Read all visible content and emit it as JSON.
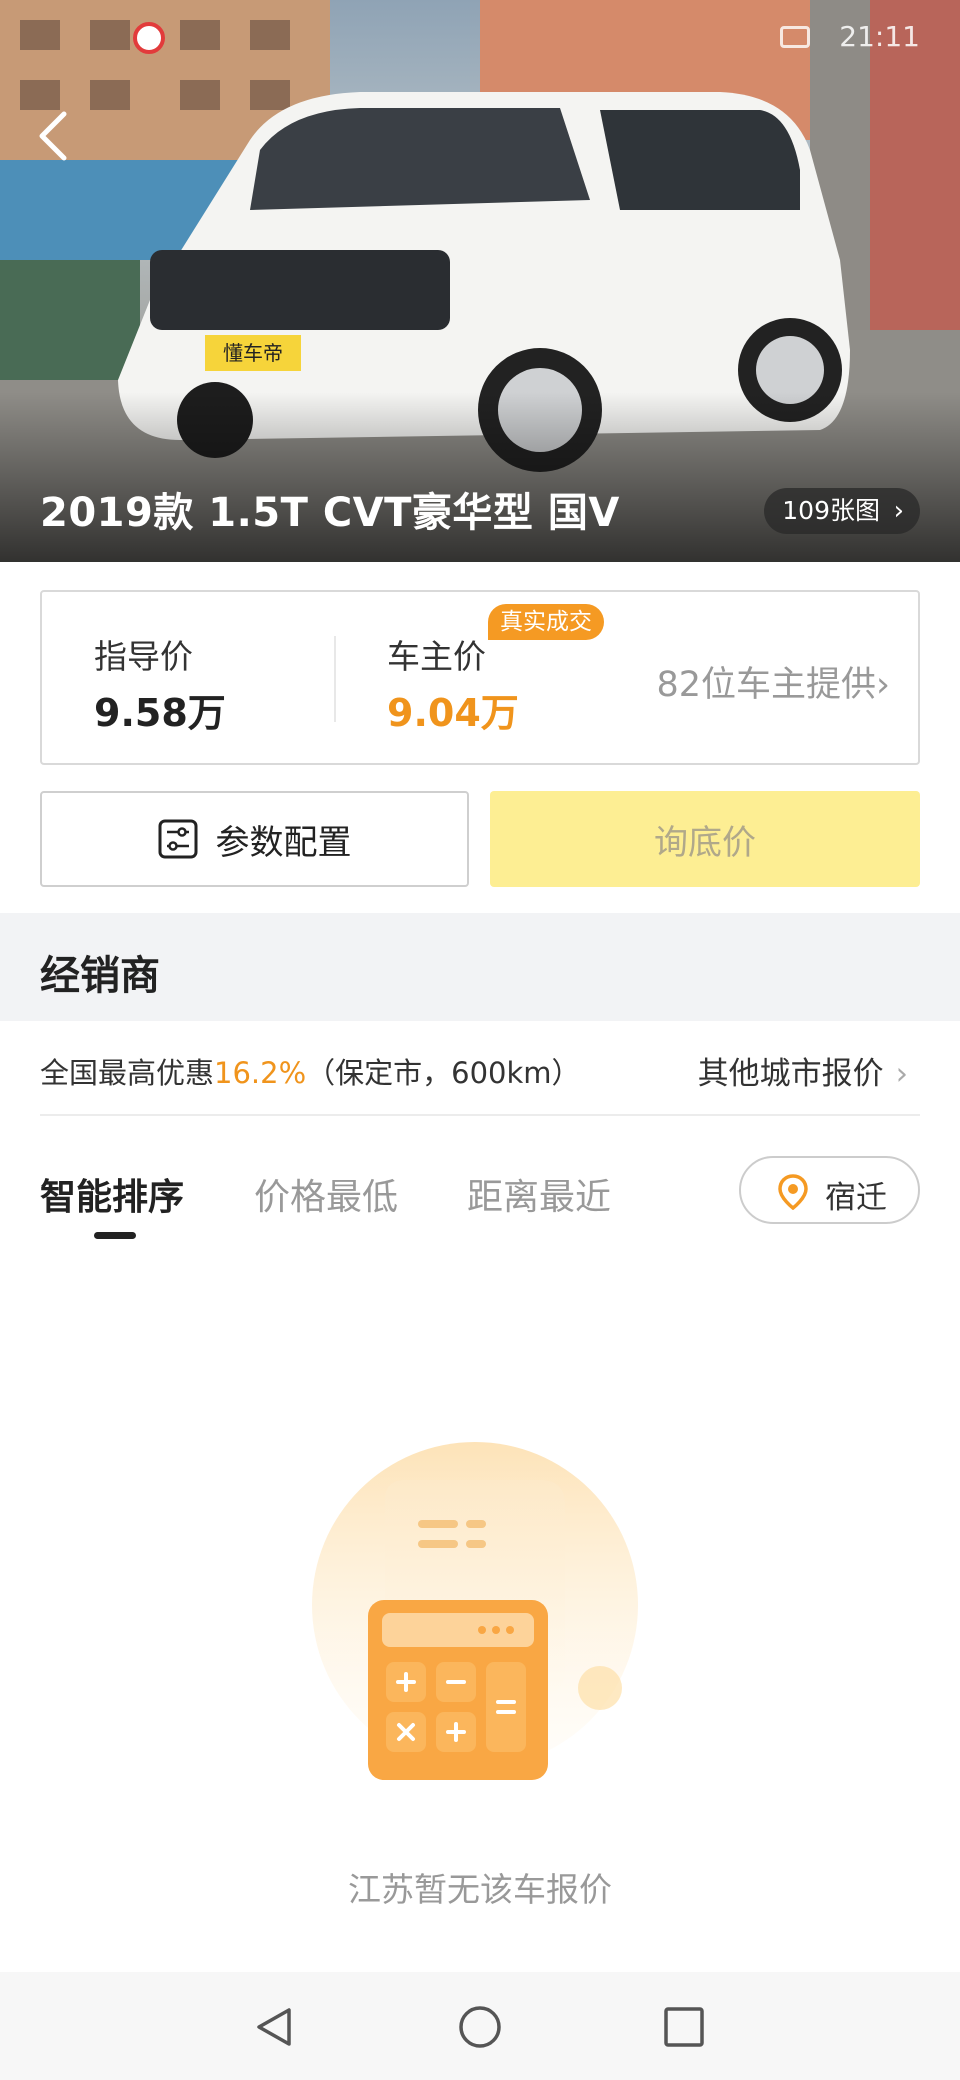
{
  "status_bar": {
    "time": "21:11"
  },
  "hero": {
    "title": "2019款 1.5T CVT豪华型 国V",
    "photo_count": "109张图",
    "chevron": "›",
    "plate_text": "懂车帝"
  },
  "price_card": {
    "guide_label": "指导价",
    "guide_value": "9.58万",
    "owner_label": "车主价",
    "owner_value": "9.04万",
    "badge": "真实成交",
    "owner_count": "82位车主提供",
    "chevron": "›"
  },
  "buttons": {
    "config": "参数配置",
    "quote": "询底价"
  },
  "dealer": {
    "title": "经销商",
    "discount_prefix": "全国最高优惠",
    "discount_value": "16.2%",
    "discount_suffix": "（保定市，600km）",
    "other_city": "其他城市报价",
    "chevron": "›"
  },
  "sort_tabs": [
    {
      "label": "智能排序",
      "active": true
    },
    {
      "label": "价格最低",
      "active": false
    },
    {
      "label": "距离最近",
      "active": false
    }
  ],
  "location": {
    "city": "宿迁"
  },
  "empty_state": {
    "message": "江苏暂无该车报价"
  },
  "colors": {
    "accent_orange": "#f0941c",
    "quote_button": "#fdee93",
    "section_bg": "#f2f3f5"
  },
  "icons": {
    "back": "chevron-left-icon",
    "config": "settings-sliders-icon",
    "location": "map-pin-icon",
    "nav_back": "triangle-back-icon",
    "nav_home": "circle-home-icon",
    "nav_recent": "square-recent-icon"
  }
}
